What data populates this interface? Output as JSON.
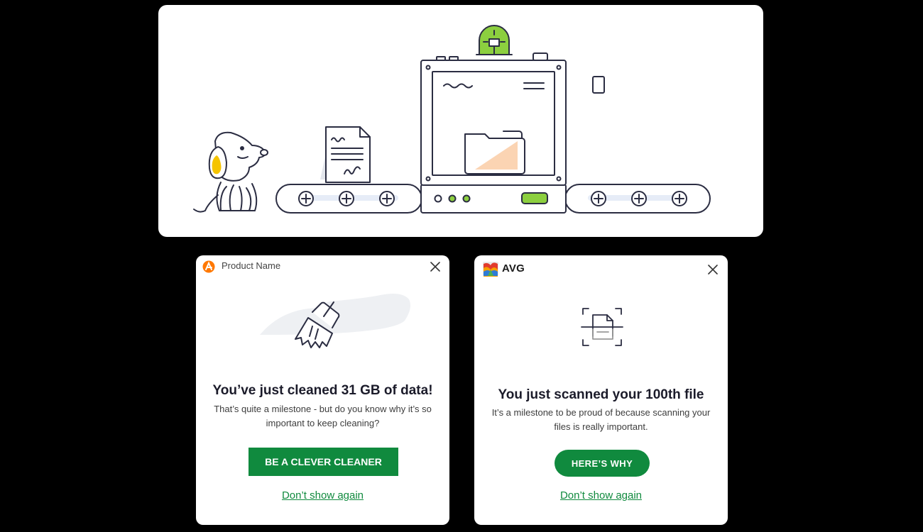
{
  "hero": {
    "illustration": "dog-watching-documents-on-conveyor-into-scanner-machine"
  },
  "cards": [
    {
      "app_logo_icon": "avast-logo-icon",
      "app_name": "Product Name",
      "close_icon": "close-icon",
      "illustration": "broom-brush-icon",
      "title": "You’ve just cleaned 31 GB of data!",
      "body": "That’s quite a milestone - but do you know why it’s so important to keep cleaning?",
      "button_label": "BE A CLEVER CLEANER",
      "link_label": "Don’t show again"
    },
    {
      "app_logo_icon": "avg-logo-icon",
      "app_name": "AVG",
      "close_icon": "close-icon",
      "illustration": "scan-file-icon",
      "title": "You just scanned your 100th file",
      "body": "It’s a milestone to be proud of because scanning your files is really important.",
      "button_label": "HERE’S WHY",
      "link_label": "Don’t show again"
    }
  ],
  "colors": {
    "brand_green": "#108a3e",
    "accent_lime": "#8ccf3f",
    "accent_peach": "#fbd4b3",
    "avast_orange": "#ff7800"
  }
}
